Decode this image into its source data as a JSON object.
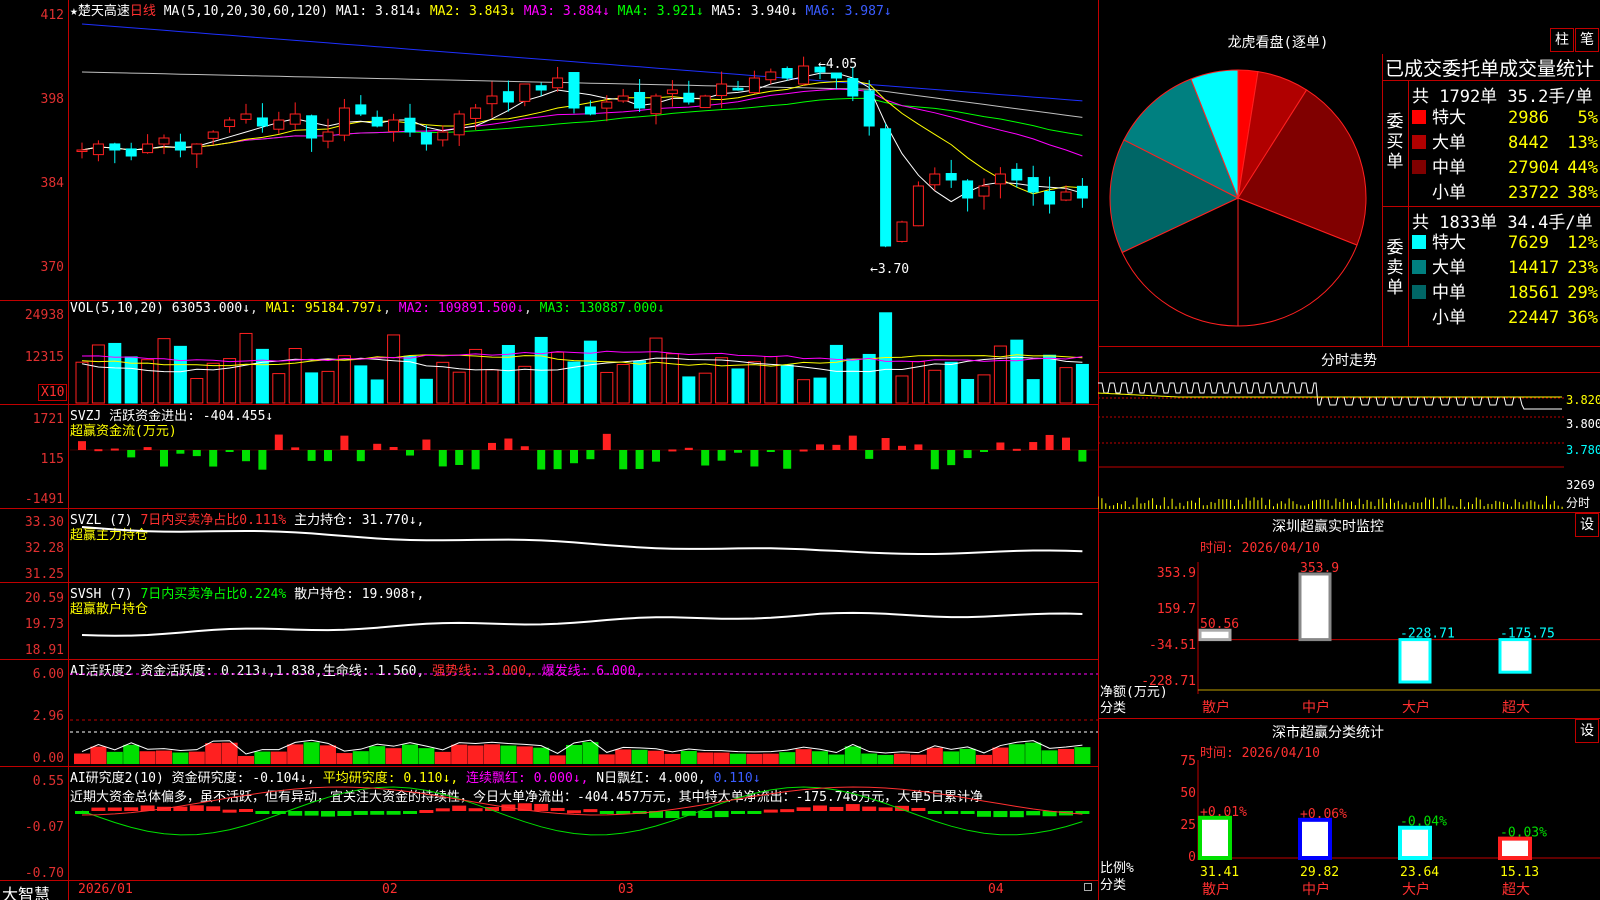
{
  "colors": {
    "up": "#ff2020",
    "down": "#00ffff",
    "frame": "#c00000",
    "ma1": "#ffffff",
    "ma2": "#ffff00",
    "ma3": "#ff00ff",
    "ma4": "#00ff00",
    "ma5": "#1e30ff",
    "ma6": "#c0c0c0"
  },
  "kline": {
    "star": "★",
    "name": "楚天高速",
    "period": "日线",
    "ma_label": "MA(5,10,20,30,60,120)",
    "ma1": "MA1: 3.814↓",
    "ma2": "MA2: 3.843↓",
    "ma3": "MA3: 3.884↓",
    "ma4": "MA4: 3.921↓",
    "ma5": "MA5: 3.940↓",
    "ma6": "MA6: 3.987↓",
    "yaxis": [
      "412",
      "398",
      "384",
      "370"
    ],
    "high_mark": "4.05",
    "low_mark": "3.70"
  },
  "vol": {
    "label": "VOL(5,10,20)",
    "value": "63053.000↓",
    "ma1": "MA1: 95184.797↓",
    "ma2": "MA2: 109891.500↓",
    "ma3": "MA3: 130887.000↓",
    "yaxis": [
      "24938",
      "12315"
    ],
    "unit": "X10"
  },
  "svzj": {
    "label": "SVZJ  活跃资金进出: -404.455↓",
    "sub": "超赢资金流(万元)",
    "yaxis": [
      "1721",
      "115",
      "-1491"
    ]
  },
  "svzl": {
    "label": "SVZL (7)",
    "mid": "7日内买卖净占比0.111%",
    "tail": "主力持仓: 31.770↓,",
    "sub": "超赢主力持仓",
    "yaxis": [
      "33.30",
      "32.28",
      "31.25"
    ]
  },
  "svsh": {
    "label": "SVSH (7)",
    "mid": "7日内买卖净占比0.224%",
    "tail": "散户持仓: 19.908↑,",
    "sub": "超赢散户持仓",
    "yaxis": [
      "20.59",
      "19.73",
      "18.91"
    ]
  },
  "ai1": {
    "label": "AI活跃度2 资金活跃度: 0.213↓,1.838,",
    "life": "生命线: 1.560,",
    "strong": "强势线: 3.000,",
    "burst": "爆发线: 6.000,",
    "yaxis": [
      "6.00",
      "2.96",
      "0.00"
    ]
  },
  "ai2": {
    "label": "AI研究度2(10) 资金研究度: -0.104↓,",
    "avg": "平均研究度: 0.110↓,",
    "cont": "连续飘红: 0.000↓,",
    "nday": "N日飘红: 4.000,",
    "nval": "0.110↓",
    "desc": "近期大资金总体偏多，虽不活跃，但有异动，宜关注大资金的持续性，今日大单净流出：-404.457万元，其中特大单净流出：-175.746万元，大单5日累计净",
    "yaxis": [
      "0.55",
      "-0.07",
      "-0.70"
    ]
  },
  "xaxis": [
    "2026/01",
    "02",
    "03",
    "04"
  ],
  "brand": "大智慧",
  "pie": {
    "title": "龙虎看盘(逐单)",
    "btn1": "柱",
    "btn2": "笔",
    "header": "已成交委托单成交量统计",
    "buy_label": "委买单",
    "sell_label": "委卖单",
    "buy_total": "共 1792单 35.2手/单",
    "sell_total": "共 1833单 34.4手/单",
    "buy": [
      {
        "name": "特大",
        "vol": "2986",
        "pct": "5%",
        "color": "#ff0000"
      },
      {
        "name": "大单",
        "vol": "8442",
        "pct": "13%",
        "color": "#b00000"
      },
      {
        "name": "中单",
        "vol": "27904",
        "pct": "44%",
        "color": "#800000"
      },
      {
        "name": "小单",
        "vol": "23722",
        "pct": "38%",
        "color": "#000000"
      }
    ],
    "sell": [
      {
        "name": "特大",
        "vol": "7629",
        "pct": "12%",
        "color": "#00ffff"
      },
      {
        "name": "大单",
        "vol": "14417",
        "pct": "23%",
        "color": "#008080"
      },
      {
        "name": "中单",
        "vol": "18561",
        "pct": "29%",
        "color": "#006666"
      },
      {
        "name": "小单",
        "vol": "22447",
        "pct": "36%",
        "color": "#000000"
      }
    ]
  },
  "intraday": {
    "title": "分时走势",
    "yaxis": [
      "3.820",
      "3.800",
      "3.780"
    ],
    "vol": "3269",
    "vol_unit": "分时"
  },
  "monitor": {
    "title": "深圳超赢实时监控",
    "btn": "设",
    "time": "时间: 2026/04/10",
    "yaxis": [
      "353.9",
      "159.7",
      "-34.51",
      "-228.71"
    ],
    "ylabel": "净额(万元)",
    "xlabel": "分类",
    "bars": [
      {
        "cat": "散户",
        "value": 50.56,
        "label": "50.56"
      },
      {
        "cat": "中户",
        "value": 353.9,
        "label": "353.9"
      },
      {
        "cat": "大户",
        "value": -228.71,
        "label": "-228.71"
      },
      {
        "cat": "超大",
        "value": -175.75,
        "label": "-175.75"
      }
    ]
  },
  "classify": {
    "title": "深市超赢分类统计",
    "btn": "设",
    "time": "时间: 2026/04/10",
    "yaxis": [
      "75",
      "50",
      "25",
      "0"
    ],
    "ylabel": "比例%",
    "xlabel": "分类",
    "bars": [
      {
        "cat": "散户",
        "value": 31.41,
        "chg": "+0.01%",
        "label": "31.41"
      },
      {
        "cat": "中户",
        "value": 29.82,
        "chg": "+0.06%",
        "label": "29.82"
      },
      {
        "cat": "大户",
        "value": 23.64,
        "chg": "-0.04%",
        "label": "23.64"
      },
      {
        "cat": "超大",
        "value": 15.13,
        "chg": "-0.03%",
        "label": "15.13"
      }
    ]
  },
  "chart_data": [
    {
      "type": "bar",
      "title": "深圳超赢实时监控",
      "categories": [
        "散户",
        "中户",
        "大户",
        "超大"
      ],
      "values": [
        50.56,
        353.9,
        -228.71,
        -175.75
      ],
      "ylabel": "净额(万元)",
      "xlabel": "分类",
      "ylim": [
        -228.71,
        353.9
      ]
    },
    {
      "type": "bar",
      "title": "深市超赢分类统计",
      "categories": [
        "散户",
        "中户",
        "大户",
        "超大"
      ],
      "values": [
        31.41,
        29.82,
        23.64,
        15.13
      ],
      "ylabel": "比例%",
      "xlabel": "分类",
      "ylim": [
        0,
        75
      ]
    },
    {
      "type": "pie",
      "title": "龙虎看盘(逐单)",
      "categories": [
        "委买特大",
        "委买大单",
        "委买中单",
        "委买小单",
        "委卖特大",
        "委卖大单",
        "委卖中单",
        "委卖小单"
      ],
      "values": [
        5,
        13,
        44,
        38,
        12,
        23,
        29,
        36
      ]
    }
  ]
}
